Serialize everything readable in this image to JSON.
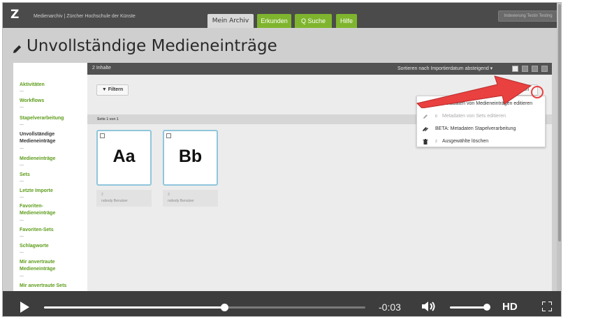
{
  "header": {
    "logo": "Z",
    "brand": "Medienarchiv | Zürcher Hochschule der Künste",
    "tabs": [
      "Mein Archiv",
      "Erkunden",
      "Q Suche",
      "Hilfe"
    ],
    "user": "Indexierung Testin Testing"
  },
  "page": {
    "title": "Unvollständige Medieneinträge"
  },
  "sidebar": {
    "items": [
      {
        "label": "Aktivitäten"
      },
      {
        "label": "Workflows"
      },
      {
        "label": "Stapelverarbeitung"
      },
      {
        "label": "Unvollständige Medieneinträge",
        "active": true
      },
      {
        "label": "Medieneinträge"
      },
      {
        "label": "Sets"
      },
      {
        "label": "Letzte Importe"
      },
      {
        "label": "Favoriten-Medieneinträge"
      },
      {
        "label": "Favoriten-Sets"
      },
      {
        "label": "Schlagworte"
      },
      {
        "label": "Mir anvertraute Medieneinträge"
      },
      {
        "label": "Mir anvertraute Sets"
      }
    ]
  },
  "content": {
    "count": "2 Inhalte",
    "sort": "Sortieren nach Importierdatum absteigend ▾",
    "filter_label": "▼ Filtern",
    "actions_label": "Aktionen",
    "page_label": "Seite 1 von 1",
    "cards": [
      {
        "glyph": "Aa",
        "title": "2",
        "subtitle": "nobody Benutzer"
      },
      {
        "glyph": "Bb",
        "title": "3",
        "subtitle": "nobody Benutzer"
      }
    ]
  },
  "dropdown": {
    "items": [
      {
        "count": "2",
        "label": "Metadaten von Medieneinträgen editieren",
        "disabled": false,
        "icon": "pencil-icon"
      },
      {
        "count": "0",
        "label": "Metadaten von Sets editieren",
        "disabled": true,
        "icon": "pencil-icon"
      },
      {
        "count": "",
        "label": "BETA: Metadaten Stapelverarbeitung",
        "disabled": false,
        "icon": "batch-pencil-icon"
      },
      {
        "count": "2",
        "label": "Ausgewählte löschen",
        "disabled": false,
        "icon": "trash-icon"
      }
    ]
  },
  "player": {
    "time": "-0:03",
    "progress": 0.56,
    "volume": 1.0,
    "quality": "HD"
  },
  "colors": {
    "accent_green": "#7fb52e",
    "annotation_red": "#e94040"
  }
}
